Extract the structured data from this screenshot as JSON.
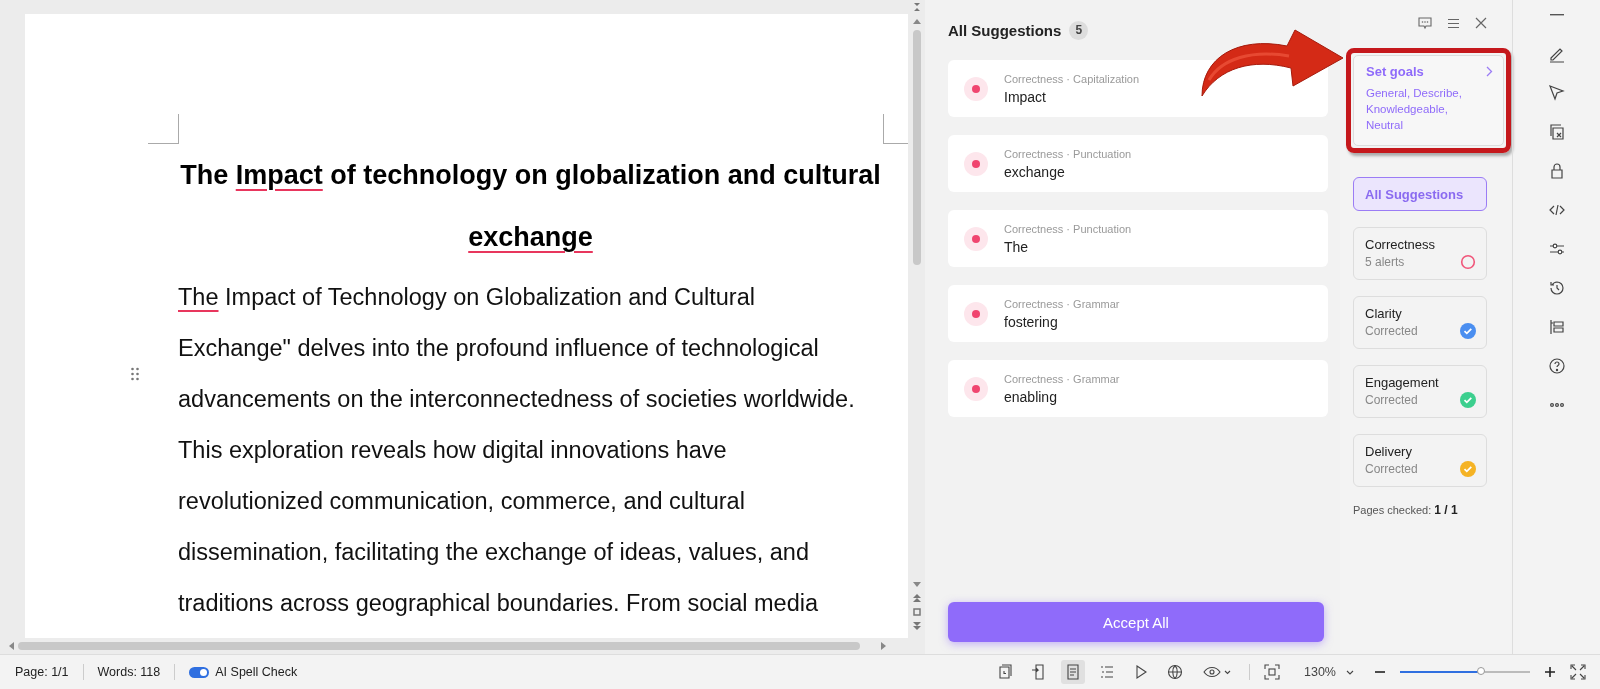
{
  "document": {
    "title_lines": [
      [
        {
          "text": "The ",
          "kind": "plain"
        },
        {
          "text": "Impact",
          "kind": "misspelled"
        },
        {
          "text": " of technology on globalization and cultural",
          "kind": "plain"
        }
      ],
      [
        {
          "text": "exchange",
          "kind": "misspelled"
        }
      ]
    ],
    "body_lines": [
      [
        {
          "text": "The",
          "kind": "misspelled"
        },
        {
          "text": " Impact of Technology on Globalization and Cultural",
          "kind": "plain"
        }
      ],
      [
        {
          "text": "Exchange\" delves into the profound influence of technological",
          "kind": "plain"
        }
      ],
      [
        {
          "text": "advancements on the interconnectedness of societies worldwide.",
          "kind": "plain"
        }
      ],
      [
        {
          "text": "This exploration reveals how digital innovations have",
          "kind": "plain"
        }
      ],
      [
        {
          "text": "revolutionized communication, commerce, and cultural",
          "kind": "plain"
        }
      ],
      [
        {
          "text": "dissemination, facilitating the exchange of ideas, values, and",
          "kind": "plain"
        }
      ],
      [
        {
          "text": "traditions across geographical boundaries. From social media",
          "kind": "plain"
        }
      ]
    ]
  },
  "suggestions": {
    "title": "All Suggestions",
    "count": "5",
    "items": [
      {
        "category": "Correctness · Capitalization",
        "word": "Impact"
      },
      {
        "category": "Correctness · Punctuation",
        "word": "exchange"
      },
      {
        "category": "Correctness · Punctuation",
        "word": "The"
      },
      {
        "category": "Correctness · Grammar",
        "word": "fostering"
      },
      {
        "category": "Correctness · Grammar",
        "word": "enabling"
      }
    ],
    "accept_button": "Accept All"
  },
  "goals": {
    "title": "Set goals",
    "values": "General, Describe, Knowledgeable, Neutral",
    "highlighted": true
  },
  "filters": [
    {
      "label": "All Suggestions",
      "selected": true
    },
    {
      "label": "Correctness",
      "status": "5 alerts",
      "kind": "alerts",
      "color": "#f0567a",
      "selected": false
    },
    {
      "label": "Clarity",
      "status": "Corrected",
      "kind": "corrected",
      "color": "#4a8ef0",
      "selected": false
    },
    {
      "label": "Engagement",
      "status": "Corrected",
      "kind": "corrected",
      "color": "#3ccf8e",
      "selected": false
    },
    {
      "label": "Delivery",
      "status": "Corrected",
      "kind": "corrected",
      "color": "#f5b324",
      "selected": false
    }
  ],
  "pages_checked": {
    "label": "Pages checked:",
    "value": "1 / 1"
  },
  "status_bar": {
    "page": "Page: 1/1",
    "words": "Words: 118",
    "spell_check": {
      "label": "AI Spell Check",
      "on": true
    },
    "view_modes": [
      {
        "selected": false
      },
      {
        "selected": false
      },
      {
        "selected": true
      },
      {
        "selected": false
      },
      {
        "selected": false
      },
      {
        "selected": false
      }
    ],
    "zoom": {
      "value": "130%",
      "level": 0.62
    }
  }
}
